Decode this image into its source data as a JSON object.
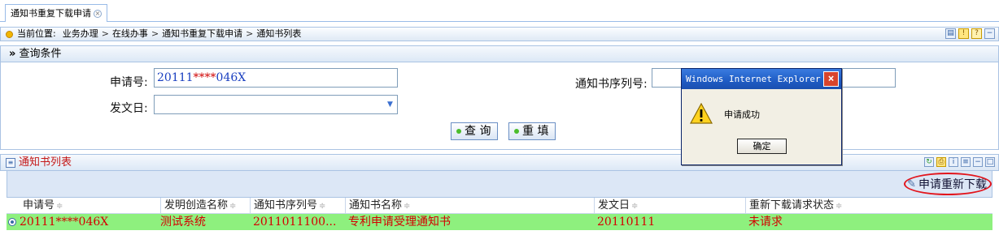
{
  "tab": {
    "label": "通知书重复下载申请"
  },
  "breadcrumb": {
    "prefix": "当前位置:",
    "items": [
      "业务办理",
      "在线办事",
      "通知书重复下载申请",
      "通知书列表"
    ],
    "separator": ">"
  },
  "query": {
    "section_title": "查询条件",
    "app_no_label": "申请号:",
    "app_no_value_start": "20111",
    "app_no_value_mask": "****",
    "app_no_value_end": "046X",
    "serial_label": "通知书序列号:",
    "serial_value": "",
    "date_label": "发文日:",
    "date_value": "",
    "search_button": "查 询",
    "reset_button": "重 填"
  },
  "list": {
    "section_title": "通知书列表",
    "reapply_button": "申请重新下载",
    "columns": [
      "申请号",
      "发明创造名称",
      "通知书序列号",
      "通知书名称",
      "发文日",
      "重新下载请求状态"
    ],
    "rows": [
      {
        "app_no_start": "20111",
        "app_no_mask": "****",
        "app_no_end": "046X",
        "invention_name": "测试系统",
        "serial_no": "2011011100...",
        "notice_name": "专利申请受理通知书",
        "issue_date": "20110111",
        "status": "未请求"
      }
    ]
  },
  "dialog": {
    "title": "Windows Internet Explorer",
    "message": "申请成功",
    "ok_button": "确定"
  },
  "icons": [
    "close-icon",
    "location-dot-icon",
    "save-icon",
    "warning-icon",
    "help-icon",
    "minimize-icon",
    "list-icon",
    "refresh-icon",
    "print-icon",
    "info-icon",
    "edit-icon",
    "sort-icon",
    "radio-icon",
    "warning-triangle-icon"
  ]
}
